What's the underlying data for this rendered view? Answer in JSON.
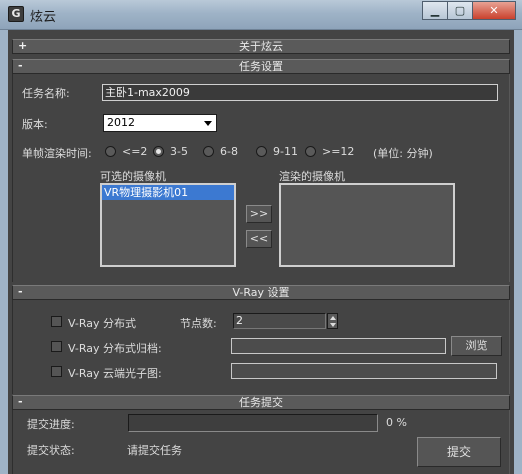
{
  "window": {
    "title": "炫云",
    "app_icon_glyph": "G",
    "minimize_icon": "minimize-icon",
    "maximize_icon": "maximize-icon",
    "close_icon": "close-icon"
  },
  "about": {
    "header": "关于炫云",
    "sign": "+"
  },
  "task_settings": {
    "header": "任务设置",
    "sign": "-",
    "task_name_label": "任务名称:",
    "task_name_value": "主卧1-max2009",
    "version_label": "版本:",
    "version_value": "2012",
    "frame_time_label": "单帧渲染时间:",
    "frame_time_options": [
      "<=2",
      "3-5",
      "6-8",
      "9-11",
      ">=12"
    ],
    "frame_time_selected": "3-5",
    "unit_note": "(单位: 分钟)",
    "available_cameras_label": "可选的摄像机",
    "available_cameras": [
      "VR物理摄影机01"
    ],
    "selected_available_camera": "VR物理摄影机01",
    "render_cameras_label": "渲染的摄像机",
    "render_cameras": [],
    "move_right_label": ">>",
    "move_left_label": "<<"
  },
  "vray": {
    "header": "V-Ray 设置",
    "sign": "-",
    "distributed_label": "V-Ray 分布式",
    "distributed_checked": false,
    "nodes_label": "节点数:",
    "nodes_value": "2",
    "distributed_archive_label": "V-Ray 分布式归档:",
    "distributed_archive_checked": false,
    "archive_path_value": "",
    "browse_label": "浏览",
    "cloud_photon_label": "V-Ray 云端光子图:",
    "cloud_photon_checked": false,
    "photon_path_value": ""
  },
  "submit": {
    "header": "任务提交",
    "sign": "-",
    "progress_label": "提交进度:",
    "progress_percent": 0,
    "progress_text": "0 %",
    "status_label": "提交状态:",
    "status_value": "请提交任务",
    "submit_button_label": "提交"
  },
  "colors": {
    "selection": "#3c79d1",
    "panel_bg": "#444444",
    "header_bg": "#5a5a5a",
    "window_frame": "#9fb3c7"
  }
}
